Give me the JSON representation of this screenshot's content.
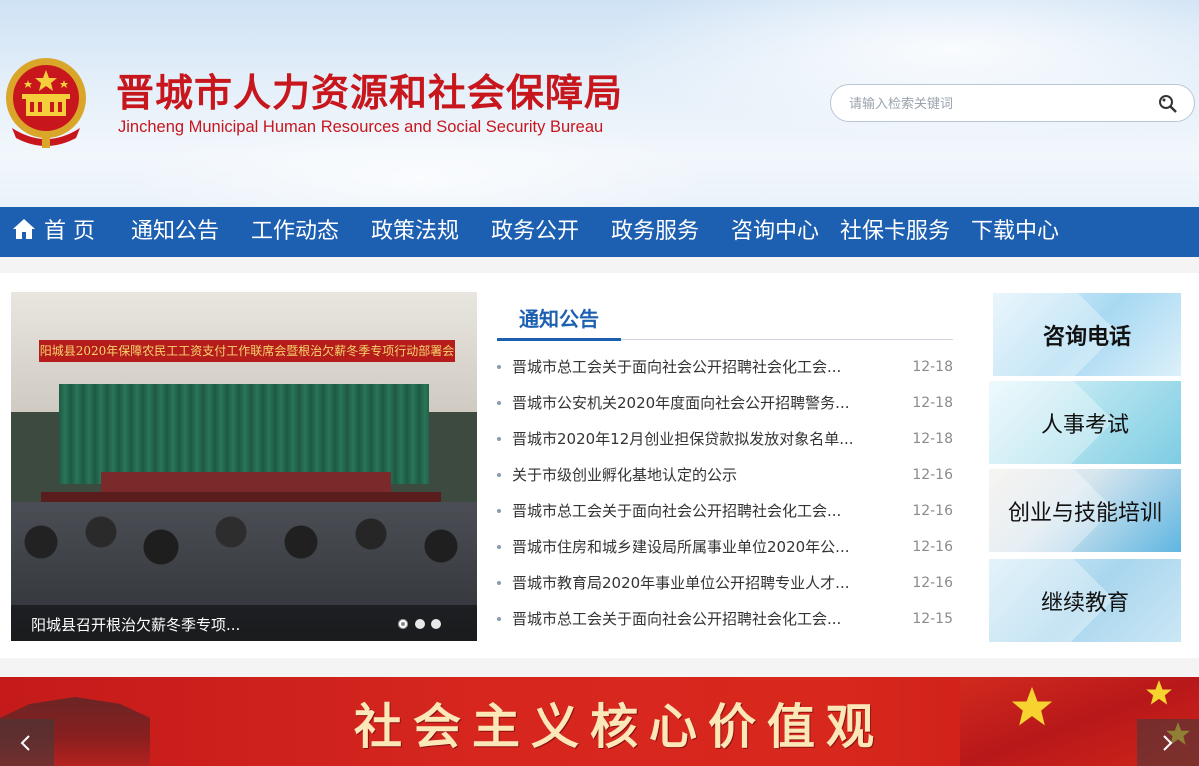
{
  "header": {
    "title": "晋城市人力资源和社会保障局",
    "subtitle": "Jincheng Municipal Human Resources and Social Security Bureau",
    "search": {
      "placeholder": "请输入检索关键词"
    }
  },
  "nav": {
    "items": [
      {
        "label": "首 页",
        "icon": "home-icon"
      },
      {
        "label": "通知公告"
      },
      {
        "label": "工作动态"
      },
      {
        "label": "政策法规"
      },
      {
        "label": "政务公开"
      },
      {
        "label": "政务服务"
      },
      {
        "label": "咨询中心"
      },
      {
        "label": "社保卡服务"
      },
      {
        "label": "下载中心"
      }
    ]
  },
  "slider": {
    "banner_text": "阳城县2020年保障农民工工资支付工作联席会暨根治欠薪冬季专项行动部署会",
    "caption": "阳城县召开根治欠薪冬季专项...",
    "dots": 3,
    "active_dot": 0
  },
  "notices": {
    "tab_title": "通知公告",
    "items": [
      {
        "title": "晋城市总工会关于面向社会公开招聘社会化工会...",
        "date": "12-18"
      },
      {
        "title": "晋城市公安机关2020年度面向社会公开招聘警务...",
        "date": "12-18"
      },
      {
        "title": "晋城市2020年12月创业担保贷款拟发放对象名单...",
        "date": "12-18"
      },
      {
        "title": "关于市级创业孵化基地认定的公示",
        "date": "12-16"
      },
      {
        "title": "晋城市总工会关于面向社会公开招聘社会化工会...",
        "date": "12-16"
      },
      {
        "title": "晋城市住房和城乡建设局所属事业单位2020年公...",
        "date": "12-16"
      },
      {
        "title": "晋城市教育局2020年事业单位公开招聘专业人才...",
        "date": "12-16"
      },
      {
        "title": "晋城市总工会关于面向社会公开招聘社会化工会...",
        "date": "12-15"
      }
    ]
  },
  "services": [
    {
      "label": "咨询电话"
    },
    {
      "label": "人事考试"
    },
    {
      "label": "创业与技能培训"
    },
    {
      "label": "继续教育"
    }
  ],
  "bottom_banner": {
    "text": "社会主义核心价值观"
  },
  "colors": {
    "brand_red": "#c8161d",
    "nav_blue": "#1d5fb0",
    "banner_red": "#d6261e"
  }
}
